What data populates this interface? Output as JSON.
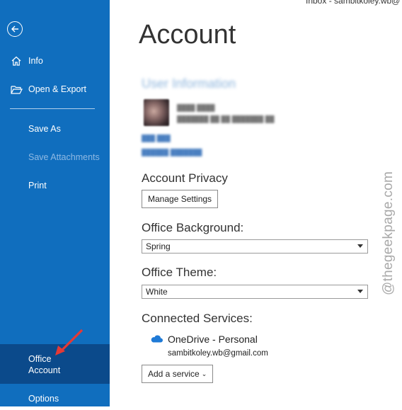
{
  "window": {
    "top_text": "Inbox - sambitkoley.wb@"
  },
  "sidebar": {
    "info": "Info",
    "open_export": "Open & Export",
    "save_as": "Save As",
    "save_attachments": "Save Attachments",
    "print": "Print",
    "office_account": "Office Account",
    "options": "Options"
  },
  "main": {
    "title": "Account",
    "user_information": "User Information",
    "account_privacy": {
      "heading": "Account Privacy",
      "button": "Manage Settings"
    },
    "office_background": {
      "heading": "Office Background:",
      "value": "Spring"
    },
    "office_theme": {
      "heading": "Office Theme:",
      "value": "White"
    },
    "connected_services": {
      "heading": "Connected Services:",
      "service_name": "OneDrive - Personal",
      "service_email": "sambitkoley.wb@gmail.com",
      "add_button": "Add a service"
    }
  },
  "watermark": "@thegeekpage.com",
  "colors": {
    "sidebar": "#106ebe",
    "sidebar_selected": "#0b4a8b",
    "annotation_arrow": "#e53935"
  }
}
